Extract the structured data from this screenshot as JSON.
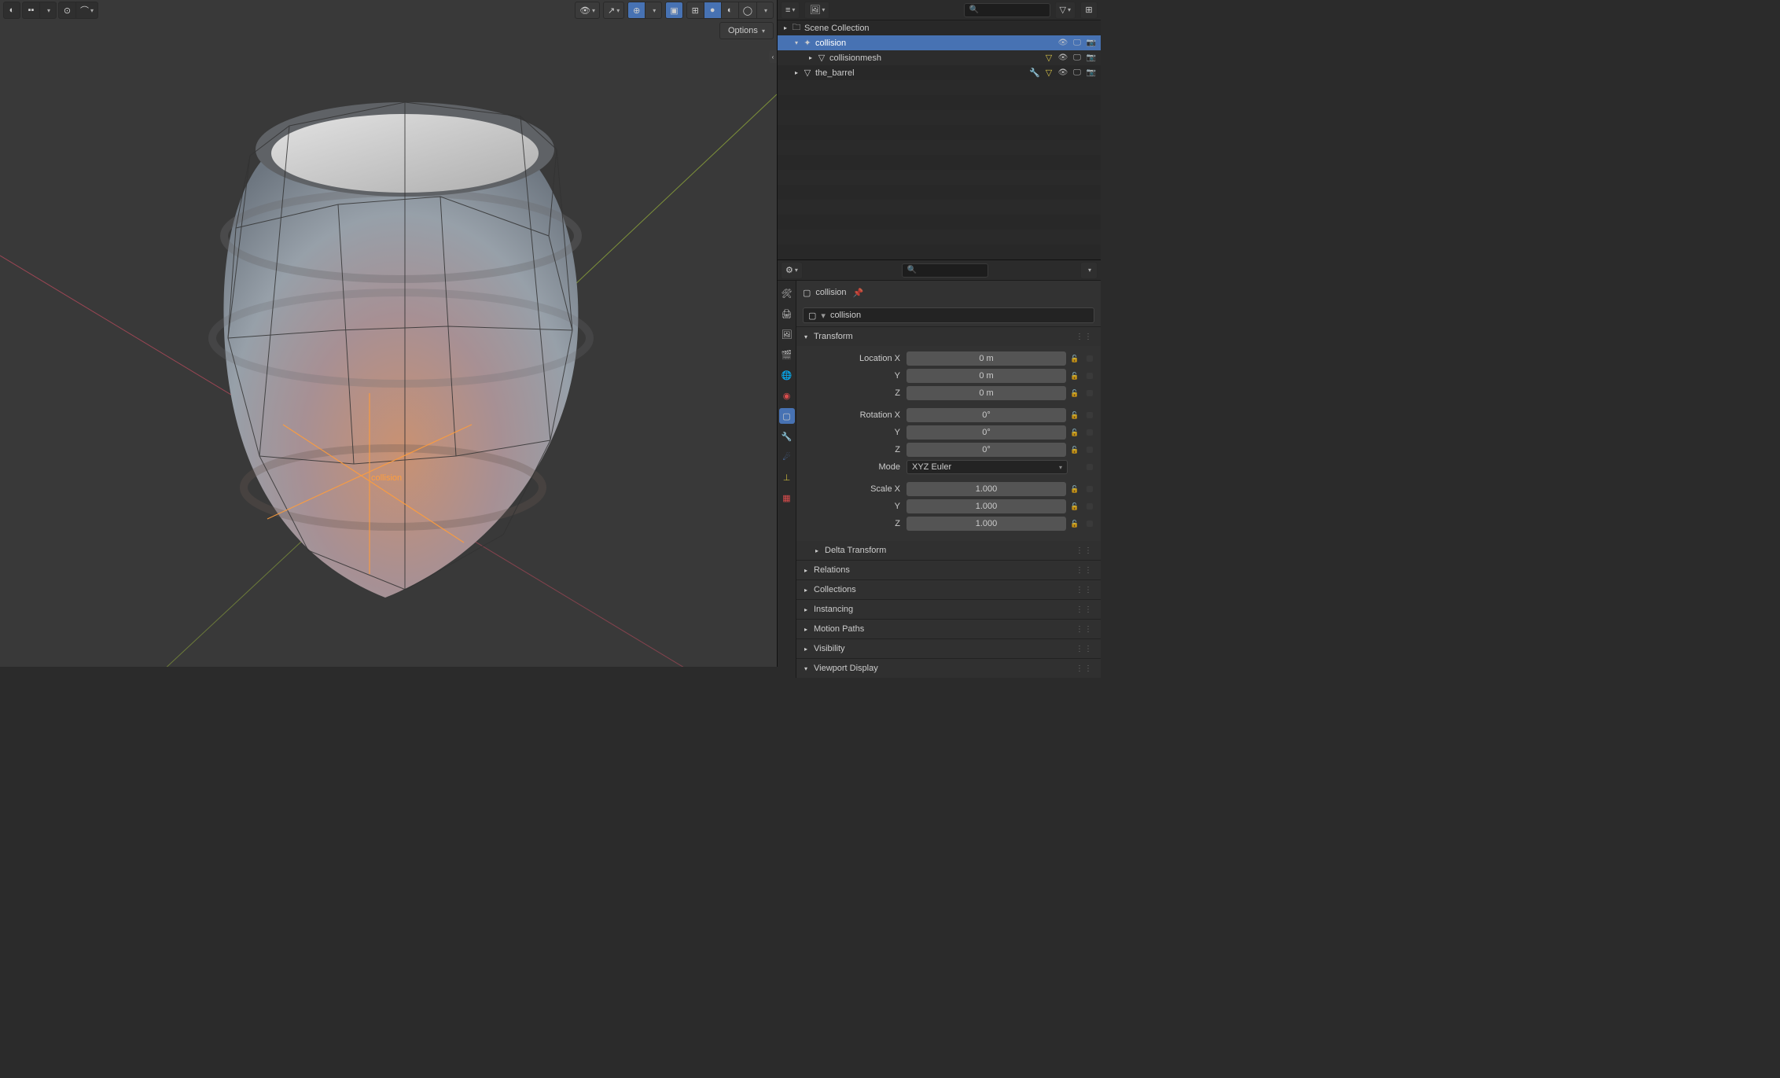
{
  "viewport": {
    "options_label": "Options",
    "selected_label": "collision"
  },
  "outliner": {
    "root": "Scene Collection",
    "items": [
      {
        "name": "collision",
        "type": "empty",
        "selected": true
      },
      {
        "name": "collisionmesh",
        "type": "mesh",
        "selected": false
      },
      {
        "name": "the_barrel",
        "type": "mesh",
        "selected": false
      }
    ]
  },
  "properties": {
    "breadcrumb_object": "collision",
    "name_field": "collision",
    "sections": {
      "transform": {
        "title": "Transform",
        "location": {
          "label": "Location",
          "x": "0 m",
          "y": "0 m",
          "z": "0 m"
        },
        "rotation": {
          "label": "Rotation",
          "x": "0°",
          "y": "0°",
          "z": "0°"
        },
        "mode": {
          "label": "Mode",
          "value": "XYZ Euler"
        },
        "scale": {
          "label": "Scale",
          "x": "1.000",
          "y": "1.000",
          "z": "1.000"
        }
      },
      "collapsed": [
        "Delta Transform",
        "Relations",
        "Collections",
        "Instancing",
        "Motion Paths",
        "Visibility",
        "Viewport Display"
      ]
    },
    "axes": [
      "X",
      "Y",
      "Z"
    ]
  }
}
